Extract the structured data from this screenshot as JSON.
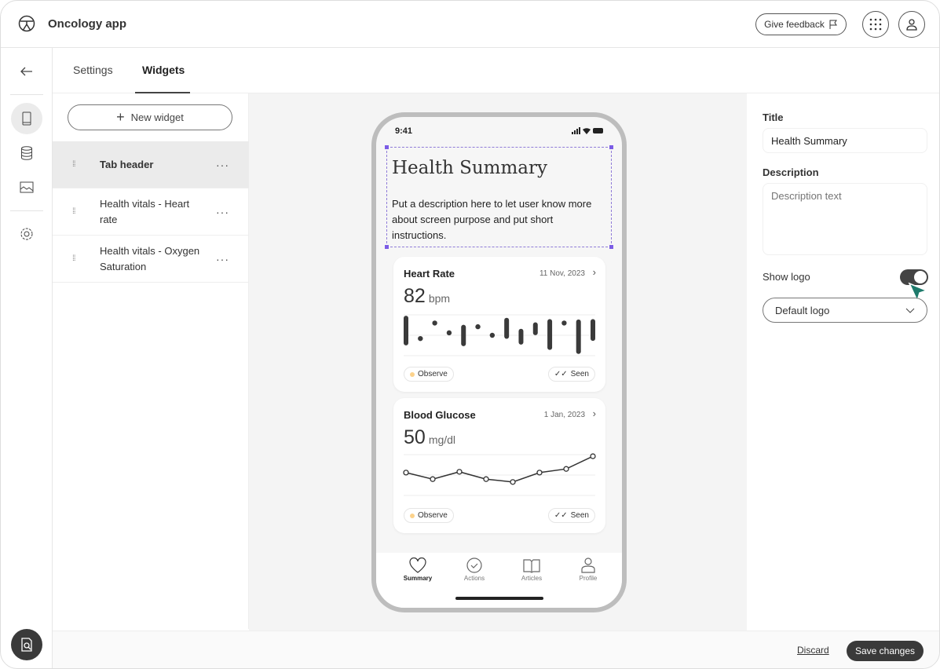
{
  "app": {
    "title": "Oncology app",
    "feedback_label": "Give feedback"
  },
  "tabs": [
    {
      "label": "Settings"
    },
    {
      "label": "Widgets"
    }
  ],
  "widgets": {
    "new_label": "New widget",
    "items": [
      {
        "label": "Tab header",
        "selected": true
      },
      {
        "label": "Health vitals - Heart rate"
      },
      {
        "label": "Health vitals - Oxygen Saturation"
      }
    ]
  },
  "phone": {
    "time": "9:41",
    "title": "Health Summary",
    "description": "Put a description here to let user know more about screen purpose and put short instructions.",
    "cards": [
      {
        "title": "Heart Rate",
        "date": "11 Nov, 2023",
        "value": "82",
        "unit": "bpm",
        "status": "Observe",
        "seen": "Seen",
        "marks": [
          [
            31,
            92
          ],
          [
            42,
            42
          ],
          [
            80,
            80
          ],
          [
            56,
            56
          ],
          [
            29,
            70
          ],
          [
            71,
            71
          ],
          [
            50,
            50
          ],
          [
            47,
            87
          ],
          [
            33,
            60
          ],
          [
            56,
            76
          ],
          [
            20,
            84
          ],
          [
            80,
            80
          ],
          [
            10,
            83
          ],
          [
            42,
            84
          ]
        ]
      },
      {
        "title": "Blood Glucose",
        "date": "1 Jan, 2023",
        "value": "50",
        "unit": "mg/dl",
        "status": "Observe",
        "seen": "Seen",
        "points": [
          56,
          40,
          58,
          40,
          33,
          56,
          65,
          96
        ]
      }
    ],
    "nav": [
      {
        "label": "Summary",
        "icon": "heart-icon",
        "active": true
      },
      {
        "label": "Actions",
        "icon": "check-circle-icon"
      },
      {
        "label": "Articles",
        "icon": "book-icon"
      },
      {
        "label": "Profile",
        "icon": "person-icon"
      }
    ]
  },
  "panel": {
    "title_label": "Title",
    "title_value": "Health Summary",
    "description_label": "Description",
    "description_placeholder": "Description text",
    "show_logo_label": "Show logo",
    "show_logo": true,
    "logo_select": "Default logo"
  },
  "footer": {
    "discard": "Discard",
    "save": "Save changes"
  },
  "colors": {
    "accent": "#3a3a3a",
    "selection": "#7b5ce6",
    "observe": "#fcd28b",
    "cursor": "#1e7a6b"
  }
}
